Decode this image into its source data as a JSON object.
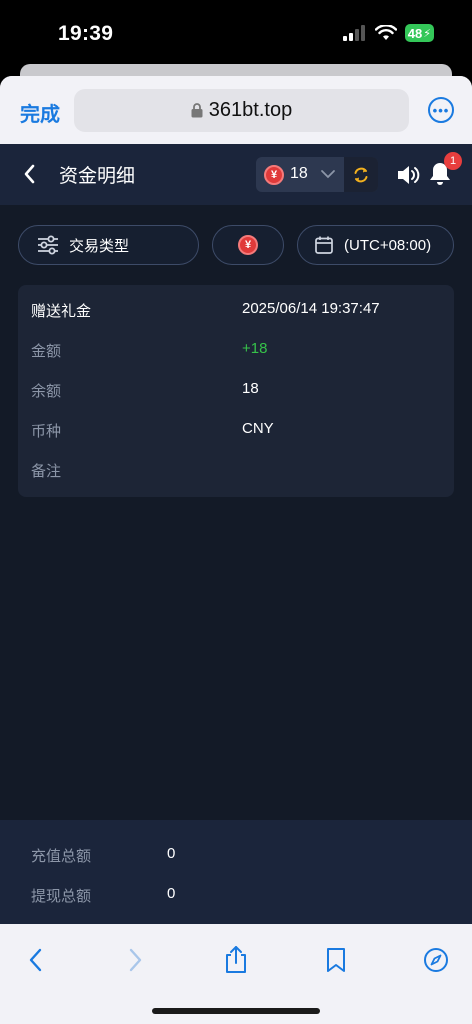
{
  "status_bar": {
    "time": "19:39",
    "battery": "48"
  },
  "browser": {
    "done_label": "完成",
    "url": "361bt.top"
  },
  "header": {
    "title": "资金明细",
    "balance": "18",
    "currency_symbol": "¥",
    "notification_count": "1"
  },
  "filters": {
    "type_label": "交易类型",
    "currency_symbol": "¥",
    "timezone_label": "(UTC+08:00)"
  },
  "record": {
    "rows": [
      {
        "label": "赠送礼金",
        "value": "2025/06/14 19:37:47"
      },
      {
        "label": "金额",
        "value": "+18"
      },
      {
        "label": "余额",
        "value": "18"
      },
      {
        "label": "币种",
        "value": "CNY"
      },
      {
        "label": "备注",
        "value": ""
      }
    ]
  },
  "summary": {
    "deposit_label": "充值总额",
    "deposit_value": "0",
    "withdraw_label": "提现总额",
    "withdraw_value": "0"
  },
  "colors": {
    "accent_blue": "#1a7ae0",
    "positive_green": "#36c24a",
    "badge_red": "#e83e3e",
    "header_bg": "#1b253b",
    "content_bg": "#131a27"
  }
}
